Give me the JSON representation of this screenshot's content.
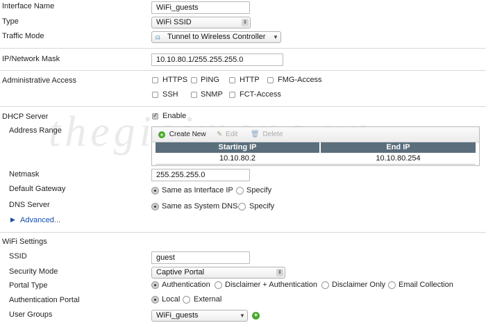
{
  "interface": {
    "name_label": "Interface Name",
    "name_value": "WiFi_guests",
    "type_label": "Type",
    "type_value": "WiFi SSID",
    "traffic_mode_label": "Traffic Mode",
    "traffic_mode_value": "Tunnel to Wireless Controller"
  },
  "ip": {
    "label": "IP/Network Mask",
    "value": "10.10.80.1/255.255.255.0"
  },
  "admin_access": {
    "label": "Administrative Access",
    "options": [
      {
        "label": "HTTPS",
        "checked": false
      },
      {
        "label": "PING",
        "checked": false
      },
      {
        "label": "HTTP",
        "checked": false
      },
      {
        "label": "FMG-Access",
        "checked": false
      },
      {
        "label": "SSH",
        "checked": false
      },
      {
        "label": "SNMP",
        "checked": false
      },
      {
        "label": "FCT-Access",
        "checked": false
      }
    ]
  },
  "dhcp": {
    "label": "DHCP Server",
    "enable_label": "Enable",
    "address_range_label": "Address Range",
    "toolbar": {
      "create": "Create New",
      "edit": "Edit",
      "delete": "Delete"
    },
    "columns": [
      "Starting IP",
      "End IP"
    ],
    "rows": [
      [
        "10.10.80.2",
        "10.10.80.254"
      ]
    ],
    "netmask_label": "Netmask",
    "netmask_value": "255.255.255.0",
    "gateway_label": "Default Gateway",
    "gateway_options": [
      "Same as Interface IP",
      "Specify"
    ],
    "dns_label": "DNS Server",
    "dns_options": [
      "Same as System DNS",
      "Specify"
    ],
    "advanced_label": "Advanced..."
  },
  "wifi": {
    "section_label": "WiFi Settings",
    "ssid_label": "SSID",
    "ssid_value": "guest",
    "security_label": "Security Mode",
    "security_value": "Captive Portal",
    "portal_type_label": "Portal Type",
    "portal_type_options": [
      "Authentication",
      "Disclaimer + Authentication",
      "Disclaimer Only",
      "Email Collection"
    ],
    "auth_portal_label": "Authentication Portal",
    "auth_portal_options": [
      "Local",
      "External"
    ],
    "user_groups_label": "User Groups",
    "user_groups_value": "WiFi_guests"
  },
  "watermark": "thegioimang.vn",
  "colors": {
    "table_header": "#5a6e7c",
    "add_green": "#44a82a",
    "advanced_blue": "#1a4fa0"
  }
}
